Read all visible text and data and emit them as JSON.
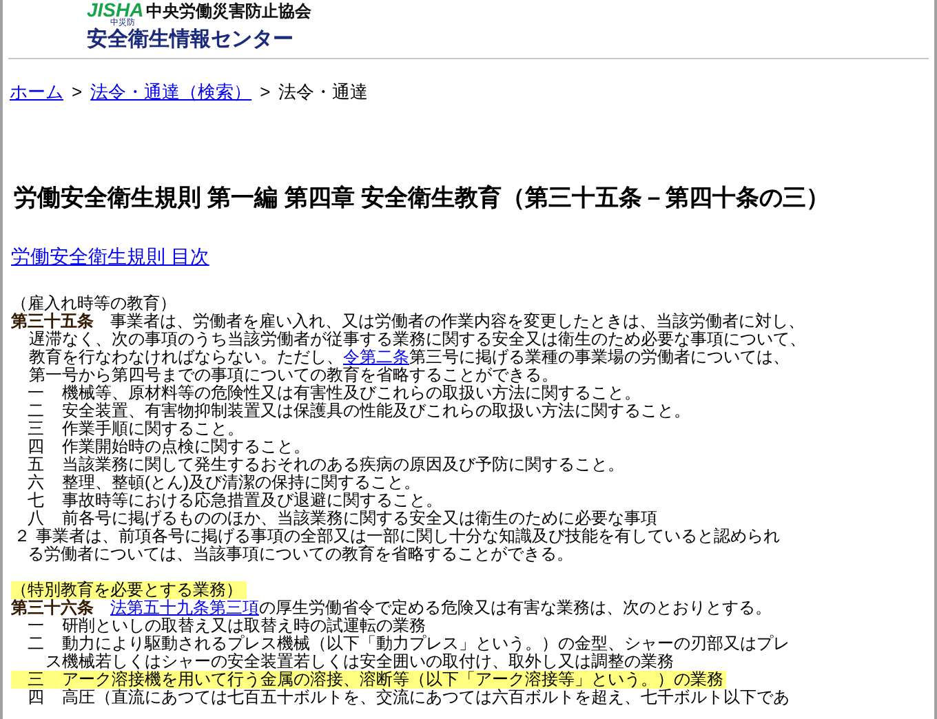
{
  "header": {
    "logo": "JISHA",
    "logo_subtitle": "中災防",
    "organization": "中央労働災害防止協会",
    "site_name": "安全衛生情報センター"
  },
  "breadcrumb": [
    {
      "label": "ホーム",
      "link": true
    },
    {
      "separator": ">",
      "label": "法令・通達（検索）",
      "link": true
    },
    {
      "separator": ">",
      "label": "法令・通達",
      "link": false
    }
  ],
  "title": "労働安全衛生規則 第一編 第四章 安全衛生教育（第三十五条－第四十条の三）",
  "toc_link": "労働安全衛生規則 目次",
  "articles": [
    {
      "caption": "（雇入れ時等の教育）",
      "caption_highlighted": false,
      "number": "第三十五条",
      "lines": [
        [
          {
            "text": "事業者は、労働者を雇い入れ、又は労働者の作業内容を変更したときは、当該労働者に対し、",
            "link": false
          }
        ],
        [
          {
            "text": "遅滞なく、次の事項のうち当該労働者が従事する業務に関する安全又は衛生のため必要な事項について、",
            "link": false
          }
        ],
        [
          {
            "text": "教育を行なわなければならない。ただし、",
            "link": false
          },
          {
            "text": "令第二条",
            "link": true
          },
          {
            "text": "第三号に掲げる業種の事業場の労働者については、",
            "link": false
          }
        ],
        [
          {
            "text": "第一号から第四号までの事項についての教育を省略することができる。",
            "link": false
          }
        ]
      ],
      "items": [
        {
          "kind": "item",
          "number": "一",
          "highlighted": false,
          "lines": [
            "機械等、原材料等の危険性又は有害性及びこれらの取扱い方法に関すること。"
          ]
        },
        {
          "kind": "item",
          "number": "二",
          "highlighted": false,
          "lines": [
            "安全装置、有害物抑制装置又は保護具の性能及びこれらの取扱い方法に関すること。"
          ]
        },
        {
          "kind": "item",
          "number": "三",
          "highlighted": false,
          "lines": [
            "作業手順に関すること。"
          ]
        },
        {
          "kind": "item",
          "number": "四",
          "highlighted": false,
          "lines": [
            "作業開始時の点検に関すること。"
          ]
        },
        {
          "kind": "item",
          "number": "五",
          "highlighted": false,
          "lines": [
            "当該業務に関して発生するおそれのある疾病の原因及び予防に関すること。"
          ]
        },
        {
          "kind": "item",
          "number": "六",
          "highlighted": false,
          "lines": [
            "整理、整頓(とん)及び清潔の保持に関すること。"
          ]
        },
        {
          "kind": "item",
          "number": "七",
          "highlighted": false,
          "lines": [
            "事故時等における応急措置及び退避に関すること。"
          ]
        },
        {
          "kind": "item",
          "number": "八",
          "highlighted": false,
          "lines": [
            "前各号に掲げるもののほか、当該業務に関する安全又は衛生のために必要な事項"
          ]
        },
        {
          "kind": "paragraph",
          "number": "２",
          "highlighted": false,
          "lines": [
            "事業者は、前項各号に掲げる事項の全部又は一部に関し十分な知識及び技能を有していると認められ",
            "る労働者については、当該事項についての教育を省略することができる。"
          ]
        }
      ]
    },
    {
      "caption": "（特別教育を必要とする業務）",
      "caption_highlighted": true,
      "number": "第三十六条",
      "lines": [
        [
          {
            "text": "法第五十九条第三項",
            "link": true
          },
          {
            "text": "の厚生労働省令で定める危険又は有害な業務は、次のとおりとする。",
            "link": false
          }
        ]
      ],
      "items": [
        {
          "kind": "item",
          "number": "一",
          "highlighted": false,
          "lines": [
            "研削といしの取替え又は取替え時の試運転の業務"
          ]
        },
        {
          "kind": "item",
          "number": "二",
          "highlighted": false,
          "lines": [
            "動力により駆動されるプレス機械（以下「動力プレス」という。）の金型、シャーの刃部又はプレ",
            "ス機械若しくはシャーの安全装置若しくは安全囲いの取付け、取外し又は調整の業務"
          ]
        },
        {
          "kind": "item",
          "number": "三",
          "highlighted": true,
          "lines": [
            "アーク溶接機を用いて行う金属の溶接、溶断等（以下「アーク溶接等」という。）の業務"
          ]
        },
        {
          "kind": "item",
          "number": "四",
          "highlighted": false,
          "lines": [
            "高圧（直流にあつては七百五十ボルトを、交流にあつては六百ボルトを超え、七千ボルト以下であ"
          ]
        }
      ]
    }
  ]
}
